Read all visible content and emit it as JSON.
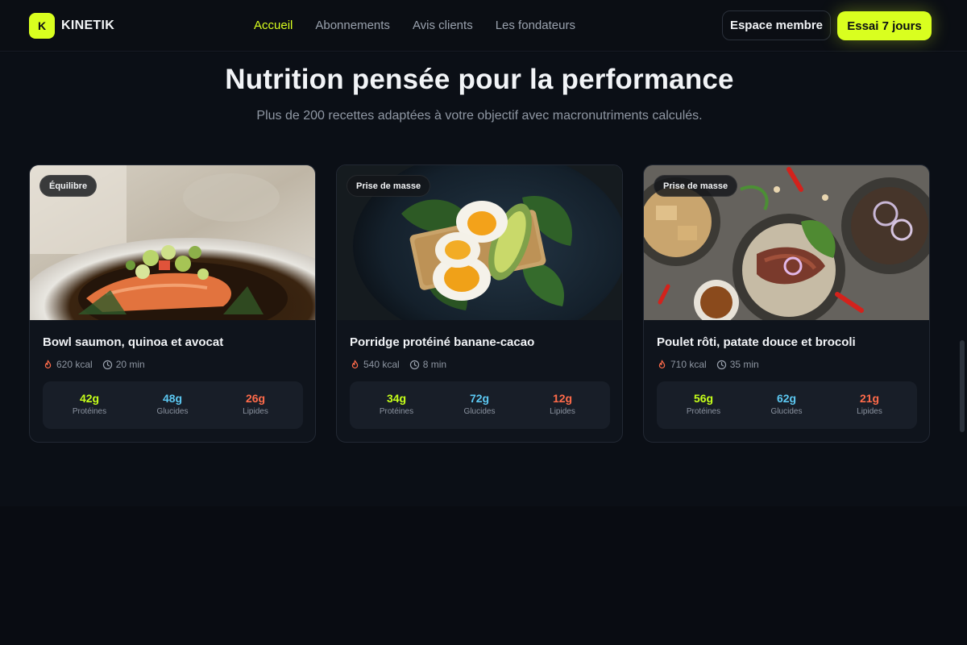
{
  "brand": {
    "logo_letter": "K",
    "name": "KINETIK",
    "accent": "#d9ff1f"
  },
  "nav": {
    "items": [
      {
        "label": "Accueil",
        "active": true
      },
      {
        "label": "Abonnements",
        "active": false
      },
      {
        "label": "Avis clients",
        "active": false
      },
      {
        "label": "Les fondateurs",
        "active": false
      }
    ]
  },
  "header": {
    "member_label": "Espace membre",
    "trial_label": "Essai 7 jours"
  },
  "section": {
    "title": "Nutrition pensée pour la performance",
    "subtitle": "Plus de 200 recettes adaptées à votre objectif avec macronutriments calculés."
  },
  "recipes": [
    {
      "tag": "Équilibre",
      "title": "Bowl saumon, quinoa et avocat",
      "kcal": "620 kcal",
      "time": "20 min",
      "macros": [
        {
          "value": "42g",
          "label": "Protéines"
        },
        {
          "value": "48g",
          "label": "Glucides"
        },
        {
          "value": "26g",
          "label": "Lipides"
        }
      ],
      "image_icon": "salmon-bowl-photo"
    },
    {
      "tag": "Prise de masse",
      "title": "Porridge protéiné banane-cacao",
      "kcal": "540 kcal",
      "time": "8 min",
      "macros": [
        {
          "value": "34g",
          "label": "Protéines"
        },
        {
          "value": "72g",
          "label": "Glucides"
        },
        {
          "value": "12g",
          "label": "Lipides"
        }
      ],
      "image_icon": "egg-toast-photo"
    },
    {
      "tag": "Prise de masse",
      "title": "Poulet rôti, patate douce et brocoli",
      "kcal": "710 kcal",
      "time": "35 min",
      "macros": [
        {
          "value": "56g",
          "label": "Protéines"
        },
        {
          "value": "62g",
          "label": "Glucides"
        },
        {
          "value": "21g",
          "label": "Lipides"
        }
      ],
      "image_icon": "meat-plates-photo"
    }
  ],
  "macro_colors": {
    "proteins": "#c6ff1a",
    "carbs": "#5cc8f2",
    "fats": "#ff6b4a"
  }
}
